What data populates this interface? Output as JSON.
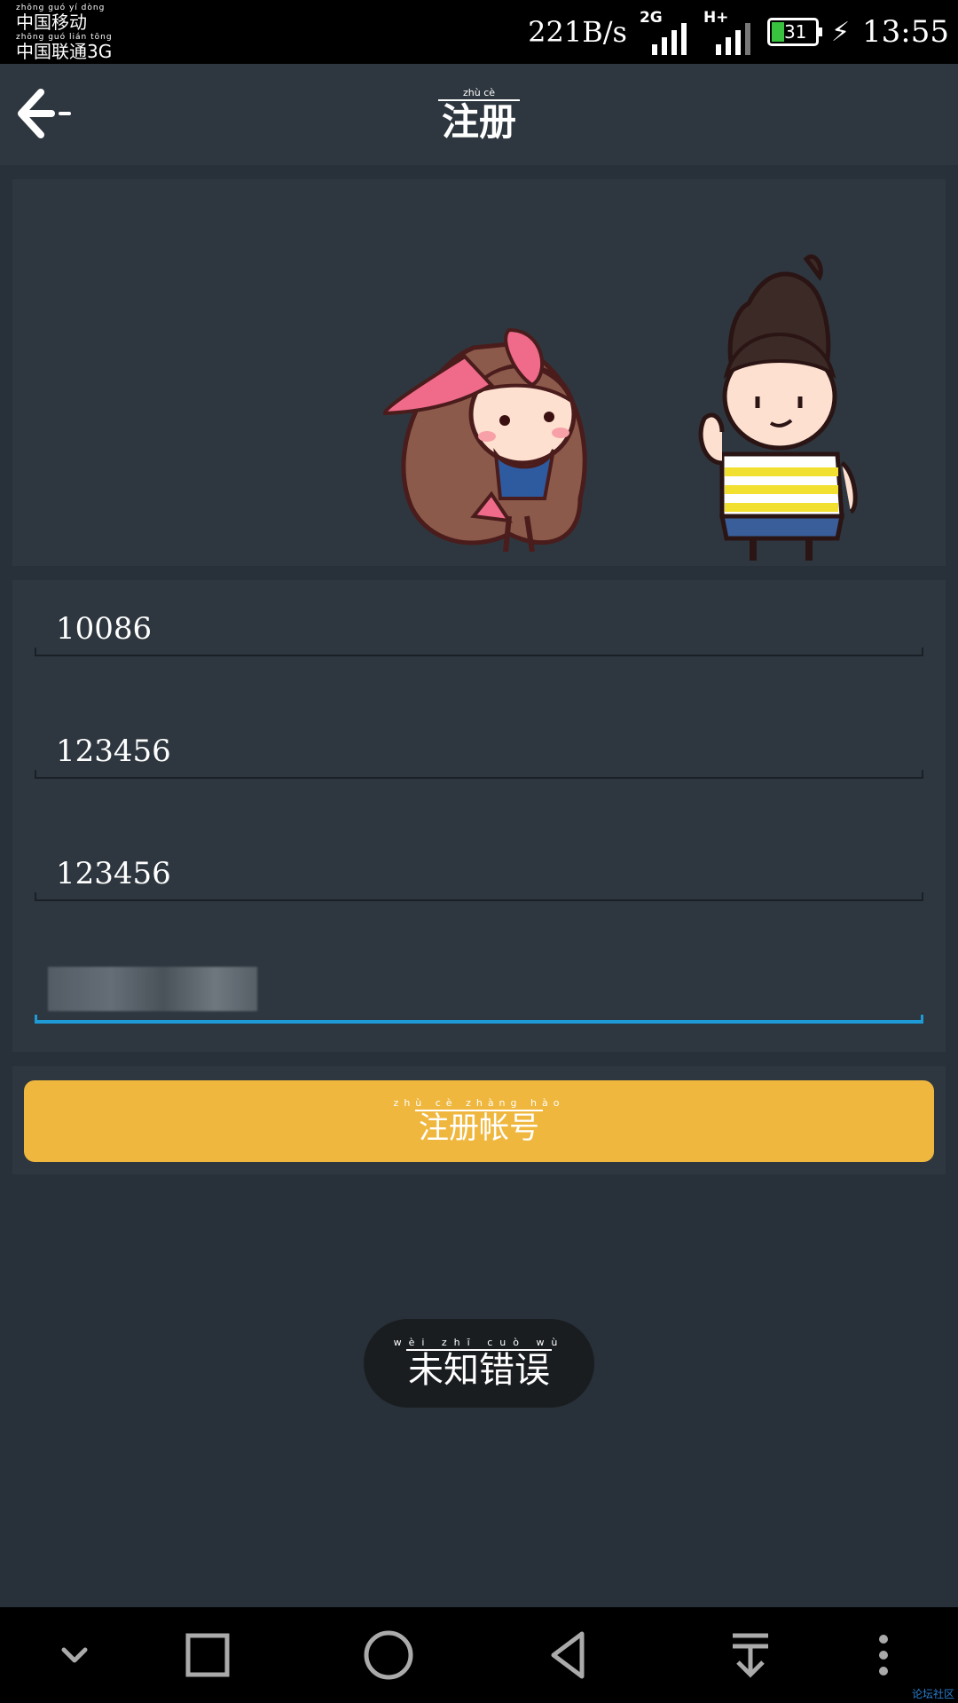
{
  "status_bar": {
    "carrier1_pinyin": "zhōng guó yí dòng",
    "carrier1": "中国移动",
    "carrier2_pinyin": "zhōng guó lián tōng",
    "carrier2": "中国联通3G",
    "net_speed": "221B/s",
    "signal1_tag": "2G",
    "signal2_tag": "H+",
    "battery": "31",
    "time": "13:55"
  },
  "app_bar": {
    "title_pinyin": "zhù cè",
    "title": "注册",
    "back_icon": "arrow-left-icon"
  },
  "form": {
    "account_value": "10086",
    "password_value": "123456",
    "confirm_password_value": "123456",
    "fourth_field_value": ""
  },
  "register_button": {
    "pinyin": "zhù cè zhàng hào",
    "label": "注册帐号"
  },
  "toast": {
    "pinyin": "wèi zhī cuò wù",
    "message": "未知错误"
  },
  "nav_bar": {
    "icons": [
      "chevron-down-icon",
      "recents-square-icon",
      "home-circle-icon",
      "back-triangle-icon",
      "pull-down-icon",
      "more-vertical-icon"
    ]
  },
  "watermark": "论坛社区",
  "colors": {
    "background": "#283039",
    "card": "#2e373f",
    "accent_button": "#efb73e",
    "focus_underline": "#1e9ad6"
  }
}
